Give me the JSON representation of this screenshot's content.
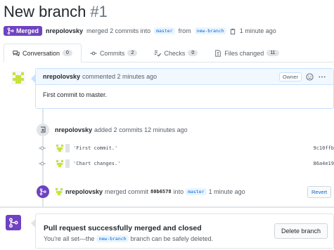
{
  "header": {
    "title": "New branch",
    "number": "#1"
  },
  "meta": {
    "status_label": "Merged",
    "author": "nrepolovsky",
    "text_merged": "merged 2 commits into",
    "base_branch": "master",
    "text_from": "from",
    "head_branch": "new-branch",
    "time": "1 minute ago"
  },
  "tabs": [
    {
      "label": "Conversation",
      "count": "0",
      "icon": "comment-discussion-icon"
    },
    {
      "label": "Commits",
      "count": "2",
      "icon": "git-commit-icon"
    },
    {
      "label": "Checks",
      "count": "0",
      "icon": "checklist-icon"
    },
    {
      "label": "Files changed",
      "count": "11",
      "icon": "file-diff-icon"
    }
  ],
  "comment": {
    "author": "nrepolovsky",
    "time_text": "commented 2 minutes ago",
    "owner_label": "Owner",
    "body": "First commit to master."
  },
  "commits_event": {
    "author": "nrepolovsky",
    "text": "added 2 commits 12 minutes ago",
    "commits": [
      {
        "message": "'First commit.'",
        "sha": "9c10ffb"
      },
      {
        "message": "'Chart changes.'",
        "sha": "86a4e19"
      }
    ]
  },
  "merge_event": {
    "author": "nrepolovsky",
    "text_merged": "merged commit",
    "sha": "80b6578",
    "text_into": "into",
    "branch": "master",
    "time": "1 minute ago",
    "revert_label": "Revert"
  },
  "merged_box": {
    "title": "Pull request successfully merged and closed",
    "sub_prefix": "You're all set—the",
    "branch": "new-branch",
    "sub_suffix": "branch can be safely deleted.",
    "delete_label": "Delete branch"
  },
  "colors": {
    "merged_purple": "#6f42c1",
    "link_blue": "#0366d6",
    "avatar_green": "#c6e33b"
  }
}
